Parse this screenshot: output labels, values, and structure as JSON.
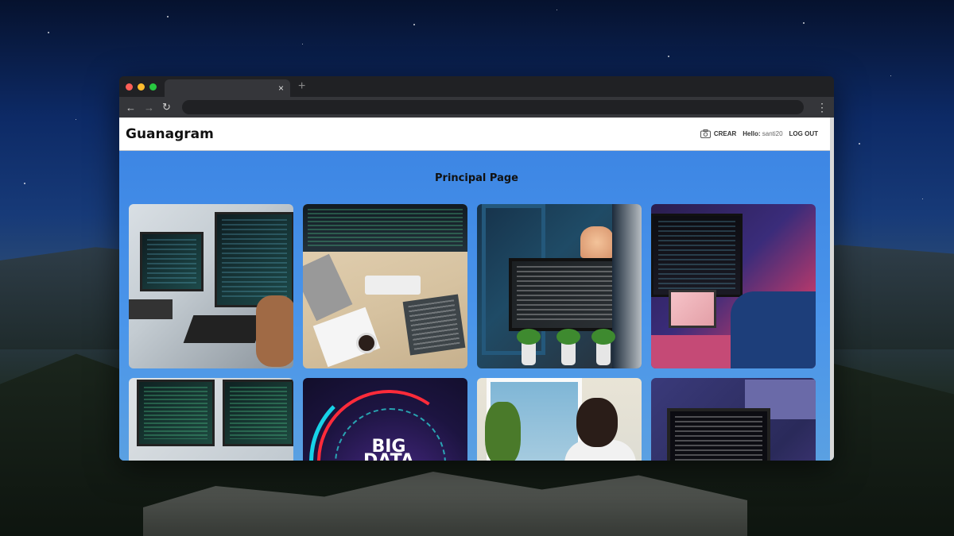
{
  "app": {
    "brand": "Guanagram"
  },
  "nav": {
    "create_label": "CREAR",
    "hello_label": "Hello:",
    "username": "santi20",
    "logout_label": "LOG OUT"
  },
  "page": {
    "title": "Principal Page"
  },
  "posts": [
    {
      "image": "developers-pointing-at-monitors-photo"
    },
    {
      "image": "desk-top-view-with-laptops-photo"
    },
    {
      "image": "monitor-with-code-and-plants-photo"
    },
    {
      "image": "programmer-neon-workspace-photo"
    },
    {
      "image": "dual-monitors-code-photo"
    },
    {
      "image": "big-data-graphic",
      "overlay_text": "BIG DATA"
    },
    {
      "image": "man-thinking-by-window-photo"
    },
    {
      "image": "monitors-with-terminal-photo"
    }
  ],
  "browser": {
    "tab_close": "×",
    "new_tab": "+",
    "menu": "⋮"
  },
  "colors": {
    "content_bg": "#3f8ae6",
    "navbar_bg": "#ffffff",
    "browser_chrome": "#202124"
  }
}
